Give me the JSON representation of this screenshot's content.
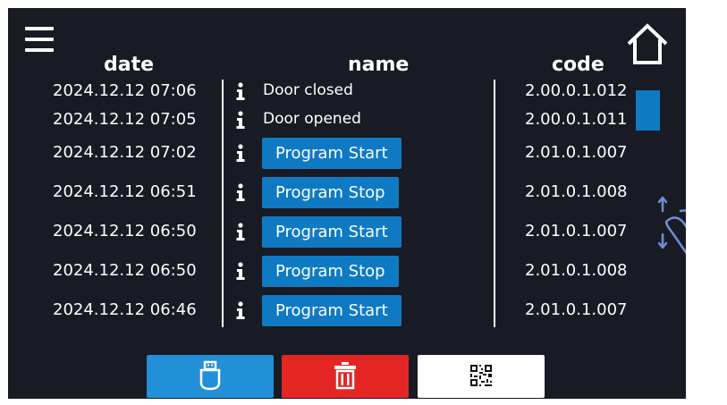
{
  "header": {
    "date": "date",
    "name": "name",
    "code": "code"
  },
  "rows": [
    {
      "date": "2024.12.12  07:06",
      "name": "Door closed",
      "code": "2.00.0.1.012",
      "is_button": false
    },
    {
      "date": "2024.12.12  07:05",
      "name": "Door opened",
      "code": "2.00.0.1.011",
      "is_button": false
    },
    {
      "date": "2024.12.12  07:02",
      "name": "Program Start",
      "code": "2.01.0.1.007",
      "is_button": true
    },
    {
      "date": "2024.12.12  06:51",
      "name": "Program Stop",
      "code": "2.01.0.1.008",
      "is_button": true
    },
    {
      "date": "2024.12.12  06:50",
      "name": "Program Start",
      "code": "2.01.0.1.007",
      "is_button": true
    },
    {
      "date": "2024.12.12  06:50",
      "name": "Program Stop",
      "code": "2.01.0.1.008",
      "is_button": true
    },
    {
      "date": "2024.12.12  06:46",
      "name": "Program Start",
      "code": "2.01.0.1.007",
      "is_button": true
    }
  ],
  "icons": {
    "menu": "hamburger-menu-icon",
    "home": "home-icon",
    "info": "info-icon",
    "usb": "usb-drive-icon",
    "delete": "trash-icon",
    "qr": "qr-code-icon",
    "scroll_gesture": "hand-swipe-gesture-icon"
  },
  "colors": {
    "screen_bg": "#181a24",
    "accent_blue": "#0f7ac4",
    "delete_red": "#e32624",
    "usb_button": "#2190d8",
    "qr_button": "#ffffff",
    "text": "#ffffff"
  }
}
